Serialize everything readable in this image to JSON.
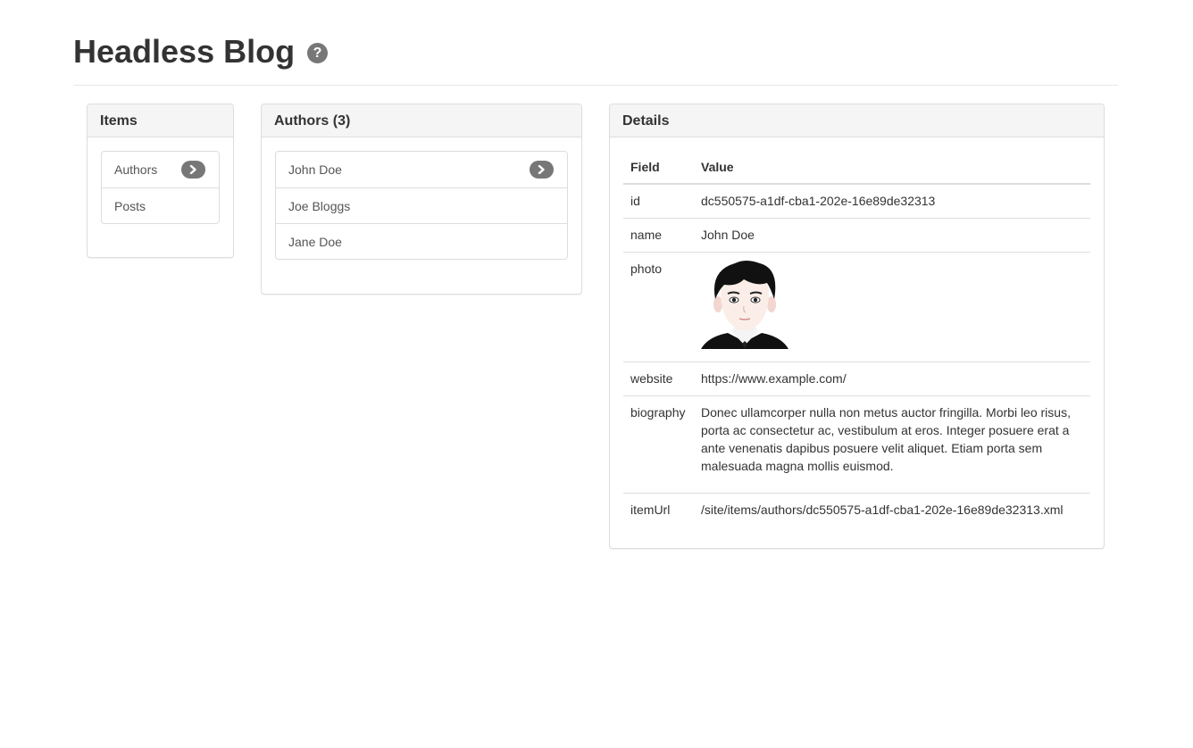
{
  "header": {
    "title": "Headless Blog",
    "help_icon": "question-circle-icon"
  },
  "items_panel": {
    "title": "Items",
    "items": [
      {
        "label": "Authors",
        "selected": true
      },
      {
        "label": "Posts",
        "selected": false
      }
    ]
  },
  "authors_panel": {
    "title": "Authors (3)",
    "items": [
      {
        "label": "John Doe",
        "selected": true
      },
      {
        "label": "Joe Bloggs",
        "selected": false
      },
      {
        "label": "Jane Doe",
        "selected": false
      }
    ]
  },
  "details_panel": {
    "title": "Details",
    "columns": {
      "field": "Field",
      "value": "Value"
    },
    "rows": {
      "id": {
        "field": "id",
        "value": "dc550575-a1df-cba1-202e-16e89de32313"
      },
      "name": {
        "field": "name",
        "value": "John Doe"
      },
      "photo": {
        "field": "photo",
        "image": "male-avatar-cartoon"
      },
      "website": {
        "field": "website",
        "value": "https://www.example.com/"
      },
      "biography": {
        "field": "biography",
        "value": "Donec ullamcorper nulla non metus auctor fringilla. Morbi leo risus, porta ac consectetur ac, vestibulum at eros. Integer posuere erat a ante venenatis dapibus posuere velit aliquet. Etiam porta sem malesuada magna mollis euismod."
      },
      "itemUrl": {
        "field": "itemUrl",
        "value": "/site/items/authors/dc550575-a1df-cba1-202e-16e89de32313.xml"
      }
    }
  },
  "colors": {
    "badge": "#777777",
    "panel_heading_bg": "#f5f5f5",
    "border": "#dddddd",
    "text": "#333333"
  }
}
